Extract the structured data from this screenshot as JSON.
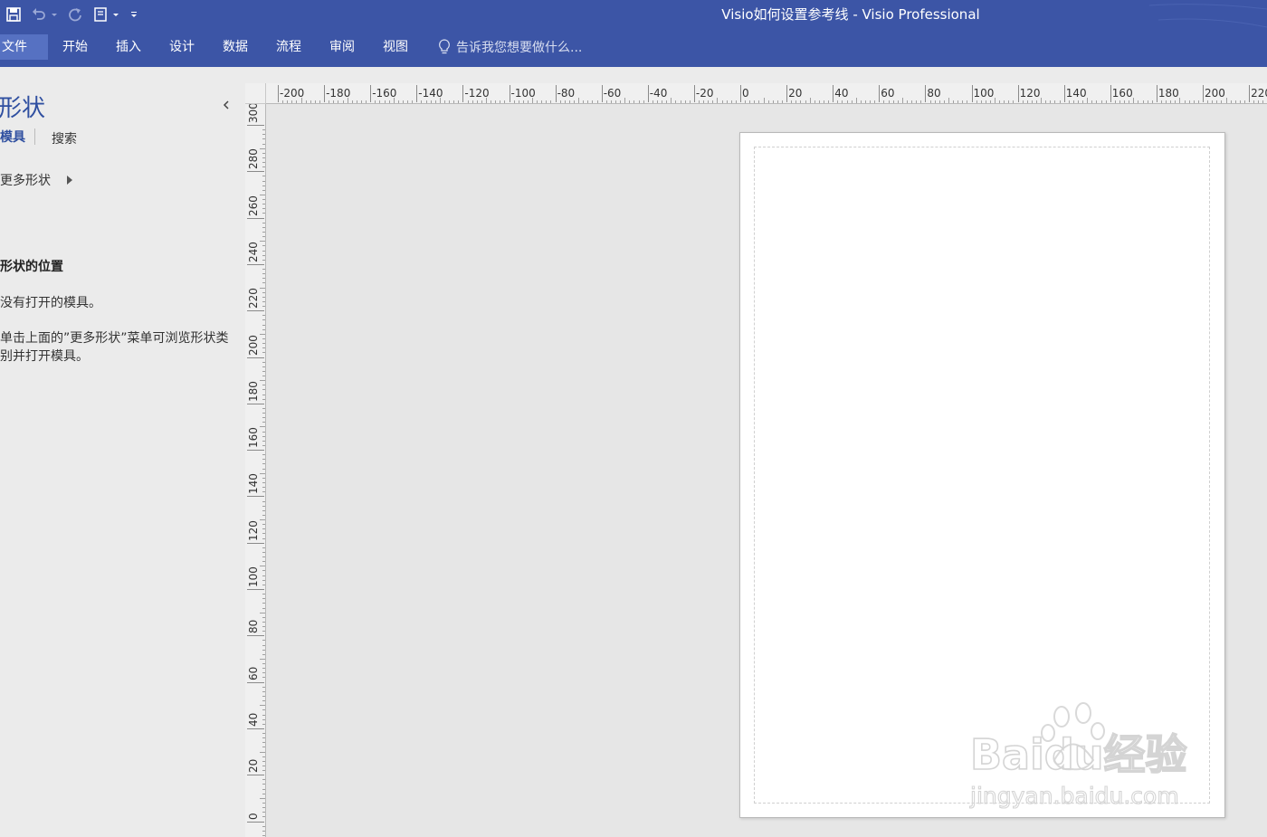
{
  "window": {
    "title": "Visio如何设置参考线 - Visio Professional"
  },
  "quick_access": {
    "icons": [
      "save-icon",
      "undo-icon",
      "redo-icon",
      "touch-mode-icon",
      "customize-icon"
    ]
  },
  "ribbon": {
    "tabs": [
      {
        "label": "文件"
      },
      {
        "label": "开始"
      },
      {
        "label": "插入"
      },
      {
        "label": "设计"
      },
      {
        "label": "数据"
      },
      {
        "label": "流程"
      },
      {
        "label": "审阅"
      },
      {
        "label": "视图"
      }
    ],
    "tell_me": "告诉我您想要做什么..."
  },
  "shapes_pane": {
    "title": "形状",
    "tab_stencils": "模具",
    "tab_search": "搜索",
    "more_shapes": "更多形状",
    "location_heading": "形状的位置",
    "no_stencils": "没有打开的模具。",
    "hint": "单击上面的”更多形状”菜单可浏览形状类别并打开模具。"
  },
  "rulers": {
    "horizontal": [
      "-200",
      "-180",
      "-160",
      "-140",
      "-120",
      "-100",
      "-80",
      "-60",
      "-40",
      "-20",
      "0",
      "20",
      "40",
      "60",
      "80",
      "100",
      "120",
      "140",
      "160",
      "180",
      "200",
      "220"
    ],
    "vertical": [
      "300",
      "280",
      "260",
      "240",
      "220",
      "200",
      "180",
      "160",
      "140",
      "120",
      "100",
      "80",
      "60",
      "40",
      "20",
      "0"
    ]
  },
  "watermark": {
    "brand": "Baidu经验",
    "url": "jingyan.baidu.com"
  },
  "colors": {
    "title_bar": "#3c55a6",
    "file_tab": "#5671c2",
    "pane_accent": "#2f4fa0"
  }
}
